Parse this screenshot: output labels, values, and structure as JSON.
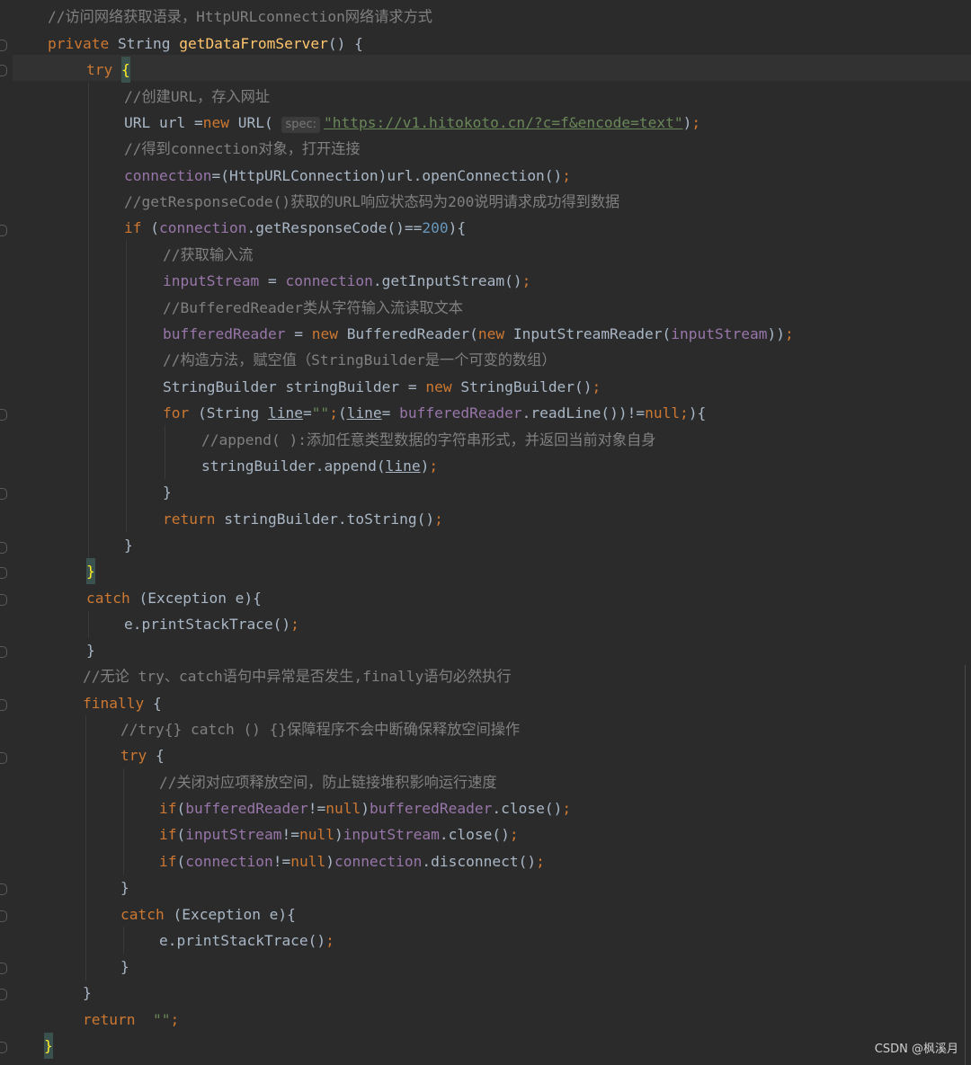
{
  "editor": {
    "lines": [
      [
        {
          "c": "cm",
          "t": "//访问网络获取语录，HttpURLconnection网络请求方式"
        }
      ],
      [
        {
          "c": "kw",
          "t": "private "
        },
        {
          "c": "pl",
          "t": "String "
        },
        {
          "c": "fn",
          "t": "getDataFromServer"
        },
        {
          "c": "pl",
          "t": "() {"
        }
      ],
      [
        {
          "c": "kw",
          "t": "try "
        },
        {
          "c": "brace-hl",
          "t": "{"
        }
      ],
      [
        {
          "c": "cm",
          "t": "//创建URL，存入网址"
        }
      ],
      [
        {
          "c": "pl",
          "t": "URL url ="
        },
        {
          "c": "kw",
          "t": "new "
        },
        {
          "c": "pl",
          "t": "URL( "
        },
        {
          "c": "hint",
          "t": "spec:"
        },
        {
          "c": "url",
          "t": "\"https://v1.hitokoto.cn/?c=f&encode=text\""
        },
        {
          "c": "pl",
          "t": ")"
        },
        {
          "c": "kw",
          "t": ";"
        }
      ],
      [
        {
          "c": "cm",
          "t": "//得到connection对象，打开连接"
        }
      ],
      [
        {
          "c": "fld",
          "t": "connection"
        },
        {
          "c": "pl",
          "t": "=(HttpURLConnection)url.openConnection()"
        },
        {
          "c": "kw",
          "t": ";"
        }
      ],
      [
        {
          "c": "cm",
          "t": "//getResponseCode()获取的URL响应状态码为200说明请求成功得到数据"
        }
      ],
      [
        {
          "c": "kw",
          "t": "if "
        },
        {
          "c": "pl",
          "t": "("
        },
        {
          "c": "fld",
          "t": "connection"
        },
        {
          "c": "pl",
          "t": ".getResponseCode()=="
        },
        {
          "c": "num",
          "t": "200"
        },
        {
          "c": "pl",
          "t": "){"
        }
      ],
      [
        {
          "c": "cm",
          "t": "//获取输入流"
        }
      ],
      [
        {
          "c": "fld",
          "t": "inputStream"
        },
        {
          "c": "pl",
          "t": " = "
        },
        {
          "c": "fld",
          "t": "connection"
        },
        {
          "c": "pl",
          "t": ".getInputStream()"
        },
        {
          "c": "kw",
          "t": ";"
        }
      ],
      [
        {
          "c": "cm",
          "t": "//BufferedReader类从字符输入流读取文本"
        }
      ],
      [
        {
          "c": "fld",
          "t": "bufferedReader"
        },
        {
          "c": "pl",
          "t": " = "
        },
        {
          "c": "kw",
          "t": "new "
        },
        {
          "c": "pl",
          "t": "BufferedReader("
        },
        {
          "c": "kw",
          "t": "new "
        },
        {
          "c": "pl",
          "t": "InputStreamReader("
        },
        {
          "c": "fld",
          "t": "inputStream"
        },
        {
          "c": "pl",
          "t": "))"
        },
        {
          "c": "kw",
          "t": ";"
        }
      ],
      [
        {
          "c": "cm",
          "t": "//构造方法，赋空值（StringBuilder是一个可变的数组）"
        }
      ],
      [
        {
          "c": "pl",
          "t": "StringBuilder stringBuilder = "
        },
        {
          "c": "kw",
          "t": "new "
        },
        {
          "c": "pl",
          "t": "StringBuilder()"
        },
        {
          "c": "kw",
          "t": ";"
        }
      ],
      [
        {
          "c": "kw",
          "t": "for "
        },
        {
          "c": "pl",
          "t": "(String "
        },
        {
          "c": "ul",
          "t": "line"
        },
        {
          "c": "pl",
          "t": "="
        },
        {
          "c": "str",
          "t": "\"\""
        },
        {
          "c": "kw",
          "t": ";"
        },
        {
          "c": "pl",
          "t": "("
        },
        {
          "c": "ul",
          "t": "line"
        },
        {
          "c": "pl",
          "t": "= "
        },
        {
          "c": "fld",
          "t": "bufferedReader"
        },
        {
          "c": "pl",
          "t": ".readLine())!="
        },
        {
          "c": "kw",
          "t": "null;"
        },
        {
          "c": "pl",
          "t": "){"
        }
      ],
      [
        {
          "c": "cm",
          "t": "//append( ):添加任意类型数据的字符串形式，并返回当前对象自身"
        }
      ],
      [
        {
          "c": "pl",
          "t": "stringBuilder.append("
        },
        {
          "c": "ul",
          "t": "line"
        },
        {
          "c": "pl",
          "t": ")"
        },
        {
          "c": "kw",
          "t": ";"
        }
      ],
      [
        {
          "c": "pl",
          "t": "}"
        }
      ],
      [
        {
          "c": "kw",
          "t": "return "
        },
        {
          "c": "pl",
          "t": "stringBuilder.toString()"
        },
        {
          "c": "kw",
          "t": ";"
        }
      ],
      [
        {
          "c": "pl",
          "t": "}"
        }
      ],
      [
        {
          "c": "brace-hl",
          "t": "}"
        }
      ],
      [
        {
          "c": "kw",
          "t": "catch "
        },
        {
          "c": "pl",
          "t": "(Exception e){"
        }
      ],
      [
        {
          "c": "pl",
          "t": "e.printStackTrace()"
        },
        {
          "c": "kw",
          "t": ";"
        }
      ],
      [
        {
          "c": "pl",
          "t": "}"
        }
      ],
      [
        {
          "c": "cm",
          "t": "//无论 try、catch语句中异常是否发生,finally语句必然执行"
        }
      ],
      [
        {
          "c": "kw",
          "t": "finally "
        },
        {
          "c": "pl",
          "t": "{"
        }
      ],
      [
        {
          "c": "cm",
          "t": "//try{} catch () {}保障程序不会中断确保释放空间操作"
        }
      ],
      [
        {
          "c": "kw",
          "t": "try "
        },
        {
          "c": "pl",
          "t": "{"
        }
      ],
      [
        {
          "c": "cm",
          "t": "//关闭对应项释放空间，防止链接堆积影响运行速度"
        }
      ],
      [
        {
          "c": "kw",
          "t": "if"
        },
        {
          "c": "pl",
          "t": "("
        },
        {
          "c": "fld",
          "t": "bufferedReader"
        },
        {
          "c": "pl",
          "t": "!="
        },
        {
          "c": "kw",
          "t": "null"
        },
        {
          "c": "pl",
          "t": ")"
        },
        {
          "c": "fld",
          "t": "bufferedReader"
        },
        {
          "c": "pl",
          "t": ".close()"
        },
        {
          "c": "kw",
          "t": ";"
        }
      ],
      [
        {
          "c": "kw",
          "t": "if"
        },
        {
          "c": "pl",
          "t": "("
        },
        {
          "c": "fld",
          "t": "inputStream"
        },
        {
          "c": "pl",
          "t": "!="
        },
        {
          "c": "kw",
          "t": "null"
        },
        {
          "c": "pl",
          "t": ")"
        },
        {
          "c": "fld",
          "t": "inputStream"
        },
        {
          "c": "pl",
          "t": ".close()"
        },
        {
          "c": "kw",
          "t": ";"
        }
      ],
      [
        {
          "c": "kw",
          "t": "if"
        },
        {
          "c": "pl",
          "t": "("
        },
        {
          "c": "fld",
          "t": "connection"
        },
        {
          "c": "pl",
          "t": "!="
        },
        {
          "c": "kw",
          "t": "null"
        },
        {
          "c": "pl",
          "t": ")"
        },
        {
          "c": "fld",
          "t": "connection"
        },
        {
          "c": "pl",
          "t": ".disconnect()"
        },
        {
          "c": "kw",
          "t": ";"
        }
      ],
      [
        {
          "c": "pl",
          "t": "}"
        }
      ],
      [
        {
          "c": "kw",
          "t": "catch "
        },
        {
          "c": "pl",
          "t": "(Exception e){"
        }
      ],
      [
        {
          "c": "pl",
          "t": "e.printStackTrace()"
        },
        {
          "c": "kw",
          "t": ";"
        }
      ],
      [
        {
          "c": "pl",
          "t": "}"
        }
      ],
      [
        {
          "c": "pl",
          "t": "}"
        }
      ],
      [
        {
          "c": "kw",
          "t": "return  "
        },
        {
          "c": "str",
          "t": "\"\""
        },
        {
          "c": "kw",
          "t": ";"
        }
      ],
      [
        {
          "c": "brace-hl",
          "t": "}"
        }
      ]
    ]
  },
  "watermark": "CSDN @枫溪月"
}
